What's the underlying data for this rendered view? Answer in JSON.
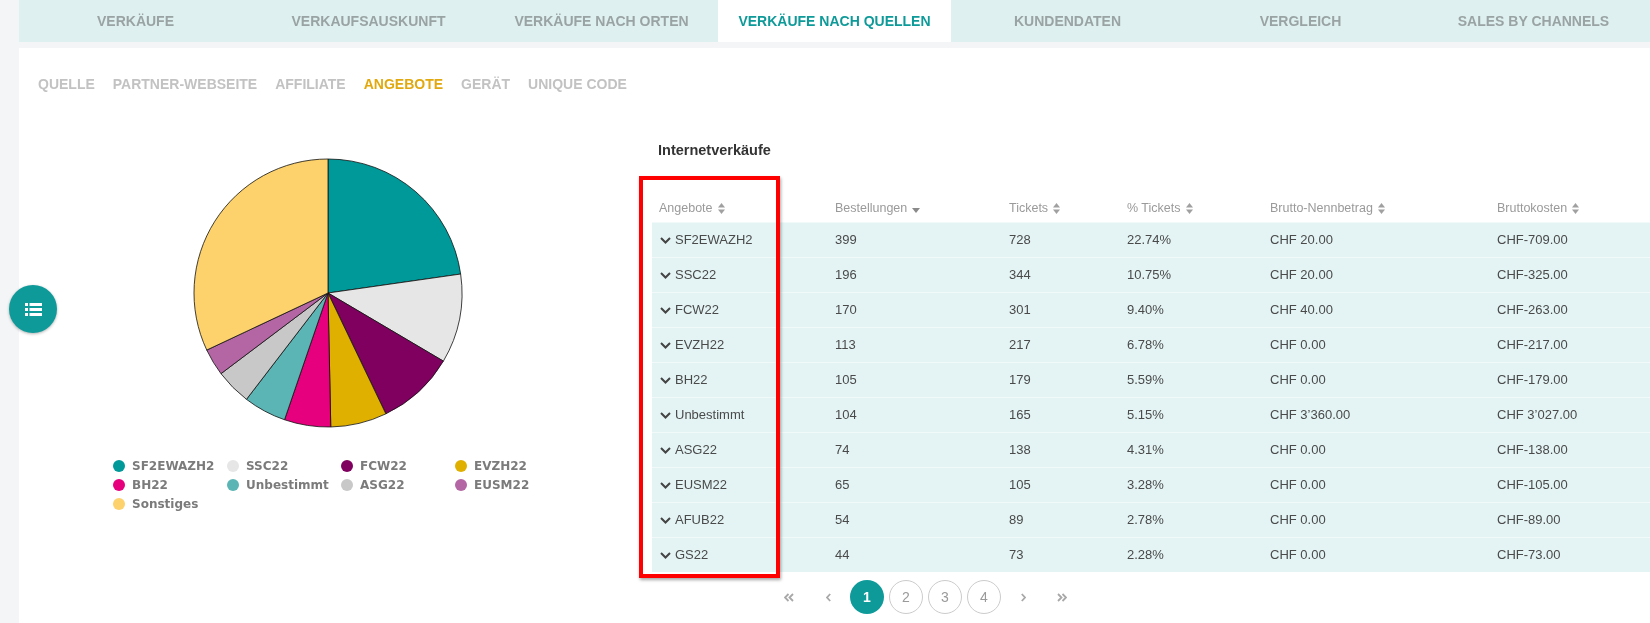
{
  "tabs": [
    {
      "label": "VERKÄUFE",
      "selected": false
    },
    {
      "label": "VERKAUFSAUSKUNFT",
      "selected": false
    },
    {
      "label": "VERKÄUFE NACH ORTEN",
      "selected": false
    },
    {
      "label": "VERKÄUFE NACH QUELLEN",
      "selected": true
    },
    {
      "label": "KUNDENDATEN",
      "selected": false
    },
    {
      "label": "VERGLEICH",
      "selected": false
    },
    {
      "label": "SALES BY CHANNELS",
      "selected": false
    }
  ],
  "sub_tabs": [
    {
      "label": "QUELLE",
      "selected": false
    },
    {
      "label": "PARTNER-WEBSEITE",
      "selected": false
    },
    {
      "label": "AFFILIATE",
      "selected": false
    },
    {
      "label": "ANGEBOTE",
      "selected": true
    },
    {
      "label": "GERÄT",
      "selected": false
    },
    {
      "label": "UNIQUE CODE",
      "selected": false
    }
  ],
  "chart": {
    "legend": [
      {
        "label": "SF2EWAZH2",
        "color": "#009999"
      },
      {
        "label": "SSC22",
        "color": "#e6e6e6"
      },
      {
        "label": "FCW22",
        "color": "#80005f"
      },
      {
        "label": "EVZH22",
        "color": "#e0b000"
      },
      {
        "label": "BH22",
        "color": "#e6007e"
      },
      {
        "label": "Unbestimmt",
        "color": "#5bb5b5"
      },
      {
        "label": "ASG22",
        "color": "#c8c8c8"
      },
      {
        "label": "EUSM22",
        "color": "#b366a3"
      },
      {
        "label": "Sonstiges",
        "color": "#fdd16b"
      }
    ]
  },
  "table": {
    "title": "Internetverkäufe",
    "columns": [
      {
        "label": "Angebote",
        "sorted": false,
        "highlighted": true
      },
      {
        "label": "Bestellungen",
        "sorted": true,
        "highlighted": false
      },
      {
        "label": "Tickets",
        "sorted": false,
        "highlighted": false
      },
      {
        "label": "% Tickets",
        "sorted": false,
        "highlighted": false
      },
      {
        "label": "Brutto-Nennbetrag",
        "sorted": false,
        "highlighted": false
      },
      {
        "label": "Bruttokosten",
        "sorted": false,
        "highlighted": false
      }
    ],
    "rows": [
      {
        "expanded": false,
        "cells": [
          "SF2EWAZH2",
          "399",
          "728",
          "22.74%",
          "CHF 20.00",
          "CHF-709.00"
        ]
      },
      {
        "expanded": false,
        "cells": [
          "SSC22",
          "196",
          "344",
          "10.75%",
          "CHF 20.00",
          "CHF-325.00"
        ]
      },
      {
        "expanded": false,
        "cells": [
          "FCW22",
          "170",
          "301",
          "9.40%",
          "CHF 40.00",
          "CHF-263.00"
        ]
      },
      {
        "expanded": false,
        "cells": [
          "EVZH22",
          "113",
          "217",
          "6.78%",
          "CHF 0.00",
          "CHF-217.00"
        ]
      },
      {
        "expanded": false,
        "cells": [
          "BH22",
          "105",
          "179",
          "5.59%",
          "CHF 0.00",
          "CHF-179.00"
        ]
      },
      {
        "expanded": false,
        "cells": [
          "Unbestimmt",
          "104",
          "165",
          "5.15%",
          "CHF 3’360.00",
          "CHF 3’027.00"
        ]
      },
      {
        "expanded": false,
        "cells": [
          "ASG22",
          "74",
          "138",
          "4.31%",
          "CHF 0.00",
          "CHF-138.00"
        ]
      },
      {
        "expanded": false,
        "cells": [
          "EUSM22",
          "65",
          "105",
          "3.28%",
          "CHF 0.00",
          "CHF-105.00"
        ]
      },
      {
        "expanded": false,
        "cells": [
          "AFUB22",
          "54",
          "89",
          "2.78%",
          "CHF 0.00",
          "CHF-89.00"
        ]
      },
      {
        "expanded": false,
        "cells": [
          "GS22",
          "44",
          "73",
          "2.28%",
          "CHF 0.00",
          "CHF-73.00"
        ]
      }
    ]
  },
  "pagination": {
    "pages": [
      {
        "label": "1",
        "selected": true
      },
      {
        "label": "2",
        "selected": false
      },
      {
        "label": "3",
        "selected": false
      },
      {
        "label": "4",
        "selected": false
      }
    ]
  }
}
